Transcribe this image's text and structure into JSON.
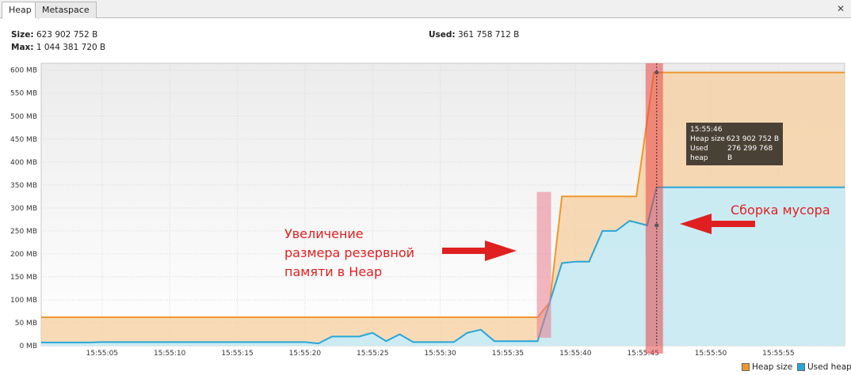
{
  "tabs": [
    {
      "label": "Heap"
    },
    {
      "label": "Metaspace"
    }
  ],
  "close_label": "✕",
  "info": {
    "size_label": "Size:",
    "size_value": "623 902 752 B",
    "max_label": "Max:",
    "max_value": "1 044 381 720 B",
    "used_label": "Used:",
    "used_value": "361 758 712 B"
  },
  "tooltip": {
    "time": "15:55:46",
    "heap_size_label": "Heap size",
    "heap_size_value": "623 902 752 B",
    "used_heap_label": "Used heap",
    "used_heap_value": "276 299 768 B"
  },
  "annotations": {
    "left_line1": "Увеличение",
    "left_line2": "размера резервной",
    "left_line3": "памяти в Heap",
    "right": "Сборка мусора"
  },
  "colors": {
    "heap_line": "#f0962e",
    "heap_fill": "#f6cf9e",
    "used_line": "#27a6d8",
    "used_fill": "#c6ecfa",
    "annotation_red": "#e02020",
    "highlight_pink": "#e87b8c",
    "highlight_red": "#e84545"
  },
  "chart_data": {
    "type": "area",
    "x_unit": "time (hh:mm:ss)",
    "y_unit": "MB",
    "ylim": [
      0,
      615
    ],
    "yticks": [
      0,
      50,
      100,
      150,
      200,
      250,
      300,
      350,
      400,
      450,
      500,
      550,
      600
    ],
    "ytick_labels": [
      "0 MB",
      "50 MB",
      "100 MB",
      "150 MB",
      "200 MB",
      "250 MB",
      "300 MB",
      "350 MB",
      "400 MB",
      "450 MB",
      "500 MB",
      "550 MB",
      "600 MB"
    ],
    "xlim": [
      "15:55:00.5",
      "15:55:59.9"
    ],
    "xticks": [
      "15:55:05",
      "15:55:10",
      "15:55:15",
      "15:55:20",
      "15:55:25",
      "15:55:30",
      "15:55:35",
      "15:55:40",
      "15:55:45",
      "15:55:50",
      "15:55:55"
    ],
    "grid": true,
    "legend": "bottom-right",
    "series": [
      {
        "name": "Heap size",
        "x": [
          "15:55:00.5",
          "15:55:37.2",
          "15:55:38.1",
          "15:55:39",
          "15:55:44.5",
          "15:55:45.8",
          "15:55:48",
          "15:55:59.9"
        ],
        "values": [
          62,
          62,
          95,
          325,
          325,
          595,
          595,
          595
        ]
      },
      {
        "name": "Used heap",
        "x": [
          "15:55:00.5",
          "15:55:04",
          "15:55:05",
          "15:55:20",
          "15:55:21",
          "15:55:22",
          "15:55:24",
          "15:55:25",
          "15:55:26",
          "15:55:27",
          "15:55:28",
          "15:55:29",
          "15:55:31",
          "15:55:32",
          "15:55:33",
          "15:55:34",
          "15:55:36",
          "15:55:37.2",
          "15:55:39",
          "15:55:40",
          "15:55:41",
          "15:55:42",
          "15:55:43",
          "15:55:44",
          "15:55:45.3",
          "15:55:46",
          "15:55:47",
          "15:55:59.9"
        ],
        "values": [
          7,
          7,
          8,
          8,
          5,
          20,
          20,
          28,
          10,
          25,
          8,
          8,
          8,
          28,
          35,
          10,
          10,
          10,
          180,
          183,
          183,
          250,
          250,
          272,
          262,
          345,
          345,
          345
        ]
      }
    ],
    "markers": [
      {
        "time": "15:55:46",
        "label": "15:55:46"
      }
    ]
  }
}
